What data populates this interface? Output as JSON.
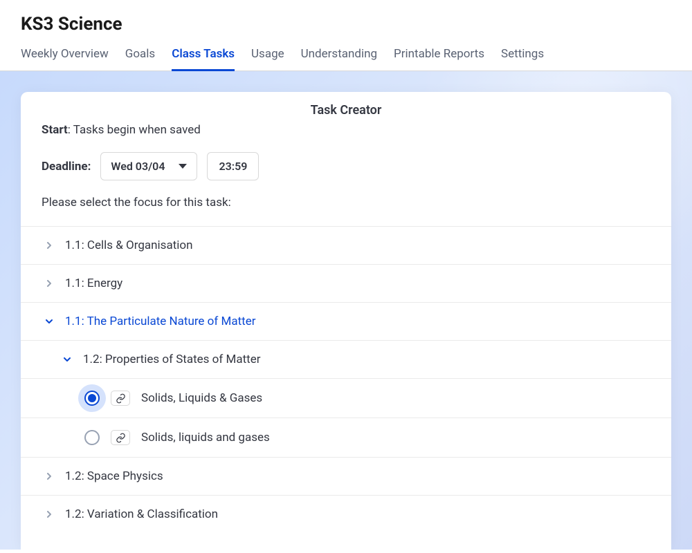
{
  "header": {
    "title": "KS3 Science"
  },
  "tabs": [
    {
      "label": "Weekly Overview",
      "active": false
    },
    {
      "label": "Goals",
      "active": false
    },
    {
      "label": "Class Tasks",
      "active": true
    },
    {
      "label": "Usage",
      "active": false
    },
    {
      "label": "Understanding",
      "active": false
    },
    {
      "label": "Printable Reports",
      "active": false
    },
    {
      "label": "Settings",
      "active": false
    }
  ],
  "card": {
    "title": "Task Creator",
    "start_label": "Start",
    "start_value": "Tasks begin when saved",
    "deadline_label": "Deadline:",
    "deadline_date": "Wed 03/04",
    "deadline_time": "23:59",
    "instruction": "Please select the focus for this task:"
  },
  "topics": [
    {
      "label": "1.1: Cells & Organisation",
      "expanded": false,
      "level": 0
    },
    {
      "label": "1.1: Energy",
      "expanded": false,
      "level": 0
    },
    {
      "label": "1.1: The Particulate Nature of Matter",
      "expanded": true,
      "level": 0
    },
    {
      "label": "1.2: Properties of States of Matter",
      "expanded": true,
      "level": 1
    },
    {
      "label": "Solids, Liquids & Gases",
      "selected": true,
      "level": 2,
      "leaf": true
    },
    {
      "label": "Solids, liquids and gases",
      "selected": false,
      "level": 2,
      "leaf": true
    },
    {
      "label": "1.2: Space Physics",
      "expanded": false,
      "level": 0
    },
    {
      "label": "1.2: Variation & Classification",
      "expanded": false,
      "level": 0
    }
  ]
}
